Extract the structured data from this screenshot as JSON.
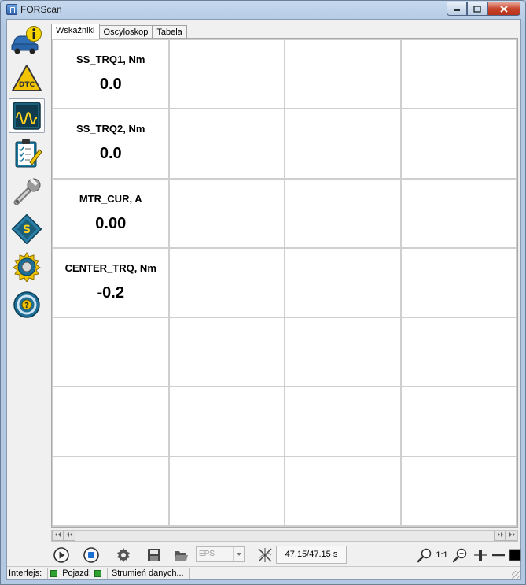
{
  "window": {
    "title": "FORScan",
    "minimize_icon": "minimize-icon",
    "maximize_icon": "maximize-icon",
    "close_icon": "close-icon"
  },
  "sidebar": {
    "items": [
      {
        "name": "vehicle-info",
        "icon": "car-info-icon",
        "active": false
      },
      {
        "name": "dtc",
        "icon": "dtc-warning-icon",
        "active": false
      },
      {
        "name": "oscilloscope",
        "icon": "waveform-icon",
        "active": true
      },
      {
        "name": "tests",
        "icon": "checklist-icon",
        "active": false
      },
      {
        "name": "service",
        "icon": "wrench-icon",
        "active": false
      },
      {
        "name": "configuration",
        "icon": "chip-icon",
        "active": false
      },
      {
        "name": "settings",
        "icon": "gear-icon",
        "active": false
      },
      {
        "name": "help",
        "icon": "help-wheel-icon",
        "active": false
      }
    ],
    "dtc_text": "DTC",
    "help_text": "?"
  },
  "tabs": [
    {
      "label": "Wskaźniki",
      "active": true
    },
    {
      "label": "Oscyloskop",
      "active": false
    },
    {
      "label": "Tabela",
      "active": false
    }
  ],
  "gauges": [
    {
      "name": "SS_TRQ1, Nm",
      "value": "0.0"
    },
    {
      "name": "SS_TRQ2, Nm",
      "value": "0.0"
    },
    {
      "name": "MTR_CUR, A",
      "value": "0.00"
    },
    {
      "name": "CENTER_TRQ, Nm",
      "value": "-0.2"
    }
  ],
  "grid": {
    "columns": 4,
    "rows": 7
  },
  "scrollbar": {
    "left_icon": "scroll-to-start-icon",
    "right_icon": "scroll-to-end-icon"
  },
  "toolbar": {
    "play_icon": "play-icon",
    "stop_icon": "stop-icon",
    "settings_icon": "gear-icon",
    "save_icon": "save-icon",
    "open_icon": "folder-open-icon",
    "module_combo": "EPS",
    "cursor_icon": "cursor-cross-icon",
    "time": "47.15/47.15 s",
    "zoom_in_icon": "zoom-in-icon",
    "ratio": "1:1",
    "zoom_out_icon": "zoom-out-icon",
    "marker_icon": "marker-icon",
    "line_icon": "line-icon",
    "color_icon": "color-square-icon"
  },
  "statusbar": {
    "interface_label": "Interfejs:",
    "vehicle_label": "Pojazd:",
    "stream_label": "Strumień danych...",
    "status_color": "#2ea12f"
  }
}
